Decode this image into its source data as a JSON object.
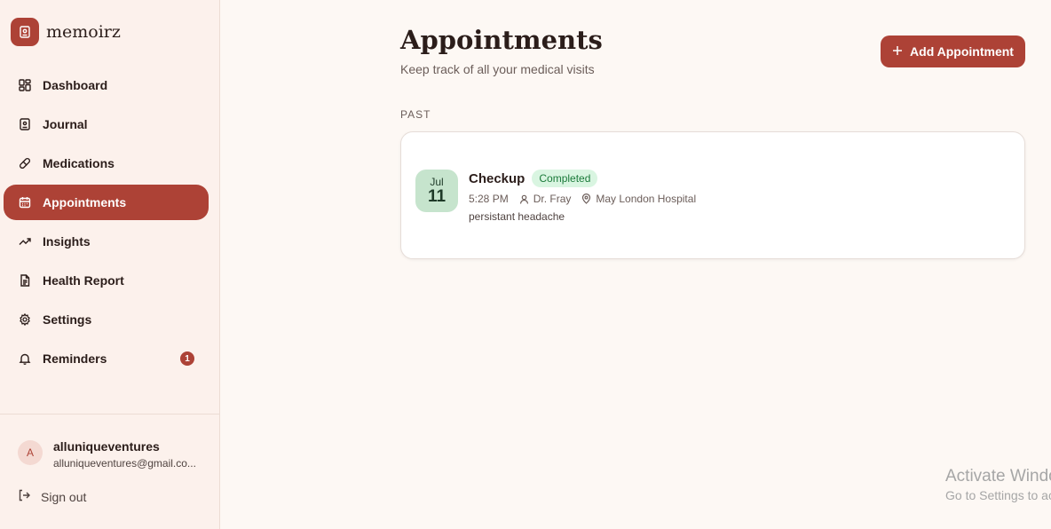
{
  "brand": {
    "name": "memoirz"
  },
  "nav": {
    "items": [
      {
        "label": "Dashboard",
        "icon": "dashboard-icon"
      },
      {
        "label": "Journal",
        "icon": "journal-icon"
      },
      {
        "label": "Medications",
        "icon": "pill-icon"
      },
      {
        "label": "Appointments",
        "icon": "calendar-icon",
        "active": true
      },
      {
        "label": "Insights",
        "icon": "trending-icon"
      },
      {
        "label": "Health Report",
        "icon": "document-icon"
      },
      {
        "label": "Settings",
        "icon": "gear-icon"
      },
      {
        "label": "Reminders",
        "icon": "bell-icon",
        "badge": "1"
      }
    ]
  },
  "user": {
    "initial": "A",
    "name": "alluniqueventures",
    "email": "alluniqueventures@gmail.co..."
  },
  "signout_label": "Sign out",
  "page": {
    "title": "Appointments",
    "subtitle": "Keep track of all your medical visits",
    "add_button_label": "Add Appointment",
    "section_label": "PAST"
  },
  "appointment": {
    "month": "Jul",
    "day": "11",
    "title": "Checkup",
    "status": "Completed",
    "time": "5:28 PM",
    "doctor": "Dr. Fray",
    "location": "May London Hospital",
    "notes": "persistant headache"
  },
  "watermark": {
    "title": "Activate Windows",
    "subtitle": "Go to Settings to activate Windows."
  },
  "colors": {
    "accent": "#ad4236",
    "sidebar_bg": "#fcf1ec",
    "page_bg": "#fdf8f4",
    "status_bg": "#d9f5e1",
    "status_text": "#1b7a3a",
    "date_bg": "#c6e4cd"
  }
}
